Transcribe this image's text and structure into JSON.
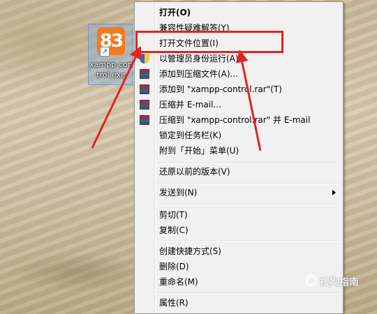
{
  "desktop_icon": {
    "logo_text": "83",
    "shortcut_glyph": "↗",
    "label": "xampp-control.exe"
  },
  "menu": {
    "items": [
      {
        "label": "打开(O)",
        "bold": true
      },
      {
        "label": "兼容性疑难解答(Y)"
      },
      {
        "label": "打开文件位置(I)"
      },
      {
        "label": "以管理员身份运行(A)",
        "icon": "shield-icon"
      },
      {
        "label": "添加到压缩文件(A)...",
        "icon": "winrar-icon"
      },
      {
        "label": "添加到 \"xampp-control.rar\"(T)",
        "icon": "winrar-icon"
      },
      {
        "label": "压缩并 E-mail...",
        "icon": "winrar-icon"
      },
      {
        "label": "压缩到 \"xampp-control.rar\" 并 E-mail",
        "icon": "winrar-icon"
      },
      {
        "label": "锁定到任务栏(K)"
      },
      {
        "label": "附到「开始」菜单(U)"
      },
      {
        "label": "还原以前的版本(V)"
      },
      {
        "label": "发送到(N)",
        "submenu": true
      },
      {
        "label": "剪切(T)"
      },
      {
        "label": "复制(C)"
      },
      {
        "label": "创建快捷方式(S)"
      },
      {
        "label": "删除(D)"
      },
      {
        "label": "重命名(M)"
      },
      {
        "label": "属性(R)"
      }
    ]
  },
  "watermark": "搜狗指南",
  "colors": {
    "annotation": "#e02424",
    "menu_bg": "#f1f1f1",
    "logo": "#f27a22"
  }
}
